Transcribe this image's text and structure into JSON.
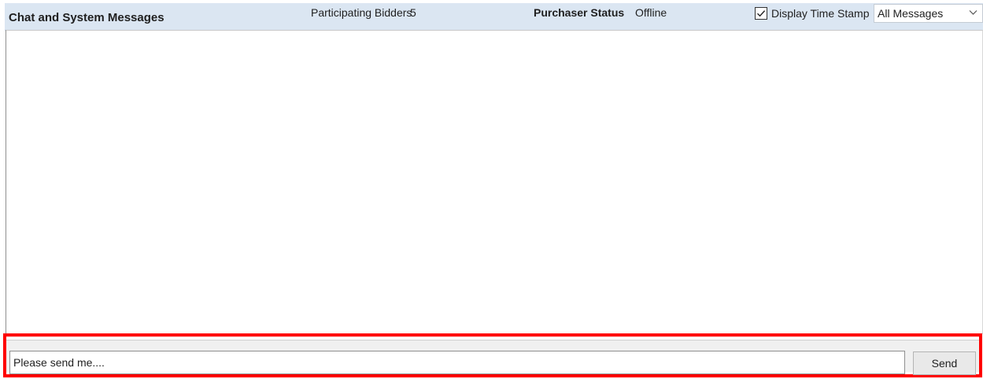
{
  "header": {
    "title": "Chat and System Messages",
    "bidders_label": "Participating Bidders",
    "bidders_count": "5",
    "purchaser_label": "Purchaser Status",
    "purchaser_status": "Offline",
    "timestamp_label": "Display Time Stamp",
    "timestamp_checked": true,
    "filter_value": "All Messages"
  },
  "messages": [],
  "compose": {
    "input_value": "Please send me....",
    "send_label": "Send",
    "highlight_color": "#ff0000"
  },
  "colors": {
    "header_background": "#dbe6f2",
    "highlight": "#ff0000"
  },
  "icons": {
    "checkbox": "check-icon",
    "dropdown": "chevron-down-icon"
  }
}
